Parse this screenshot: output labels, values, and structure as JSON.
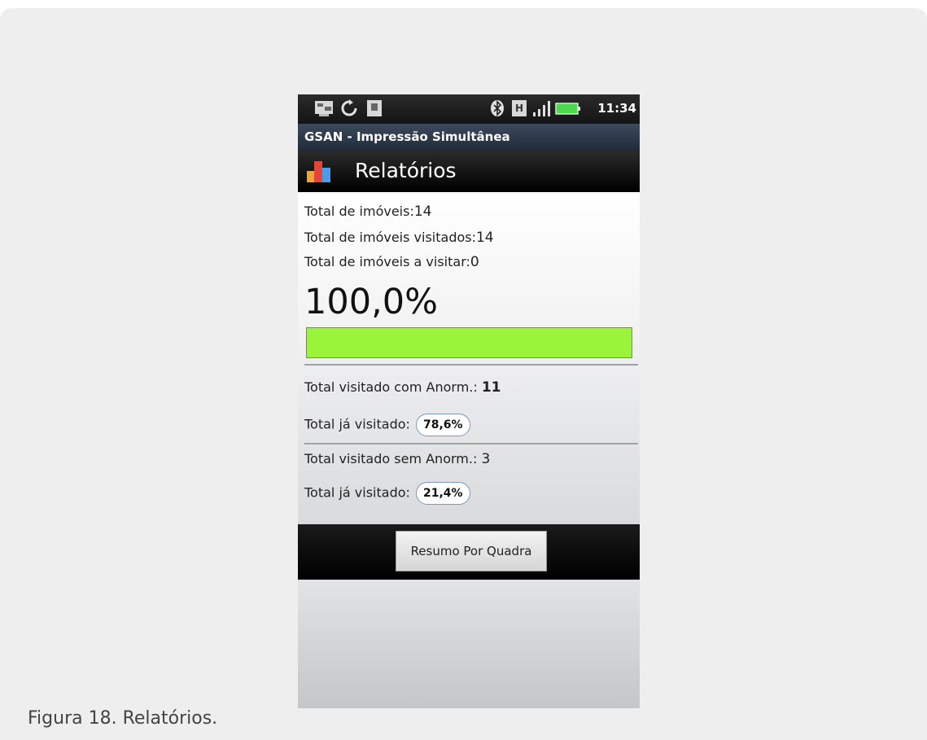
{
  "status_bar": {
    "time": "11:34",
    "icons": [
      "usb-debug-icon",
      "sync-icon",
      "sd-card-icon",
      "bluetooth-icon",
      "h-network-icon",
      "signal-icon",
      "battery-icon"
    ],
    "battery_color": "#4cd94c"
  },
  "app": {
    "name": "GSAN - Impressão Simultânea"
  },
  "screen": {
    "title": "Relatórios",
    "icon": "bar-chart-icon"
  },
  "report": {
    "total_imoveis_label": "Total de imóveis:",
    "total_imoveis_value": "14",
    "total_visitados_label": "Total de imóveis visitados:",
    "total_visitados_value": "14",
    "total_a_visitar_label": "Total de imóveis a visitar:",
    "total_a_visitar_value": "0",
    "percent_text": "100,0%",
    "progress_fraction": 1.0,
    "progress_color": "#99f43a",
    "com_anorm_label": "Total visitado com Anorm.: ",
    "com_anorm_value": "11",
    "com_anorm_visited_label": "Total já visitado:",
    "com_anorm_visited_pct": "78,6%",
    "sem_anorm_label": "Total visitado sem Anorm.: ",
    "sem_anorm_value": "3",
    "sem_anorm_visited_label": "Total já visitado:",
    "sem_anorm_visited_pct": "21,4%"
  },
  "actions": {
    "resumo_label": "Resumo Por Quadra"
  },
  "caption": "Figura 18. Relatórios."
}
